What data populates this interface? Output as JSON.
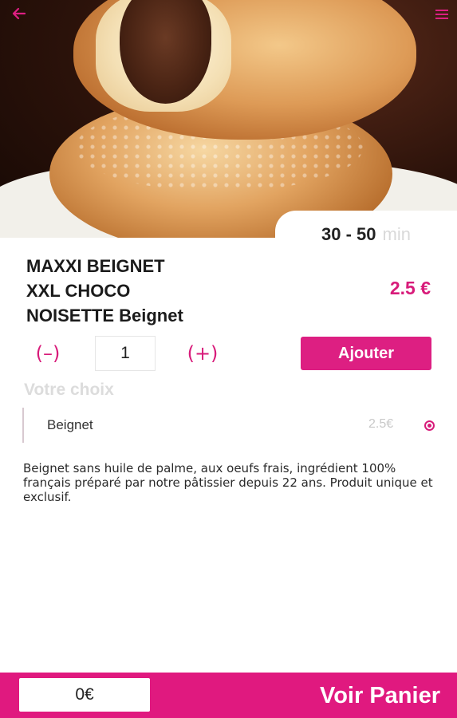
{
  "header": {
    "back_icon": "arrow-left-icon",
    "menu_icon": "hamburger-menu-icon",
    "accent_color": "#dd1f82"
  },
  "delivery_time": {
    "range": "30 - 50",
    "unit": "min"
  },
  "product": {
    "title_lines": [
      "MAXXI BEIGNET",
      "XXL CHOCO",
      "NOISETTE Beignet"
    ],
    "price": "2.5 €",
    "description": "Beignet sans huile de palme, aux oeufs frais, ingrédient 100% français préparé par notre pâtissier depuis 22 ans. Produit unique et exclusif."
  },
  "quantity": {
    "minus_label": "(–)",
    "value": "1",
    "plus_label": "(+)"
  },
  "add_button": {
    "label": "Ajouter"
  },
  "choices": {
    "heading": "Votre choix",
    "options": [
      {
        "name": "Beignet",
        "price": "2.5€",
        "selected": true
      }
    ]
  },
  "footer": {
    "total": "0€",
    "cart_label": "Voir Panier"
  }
}
